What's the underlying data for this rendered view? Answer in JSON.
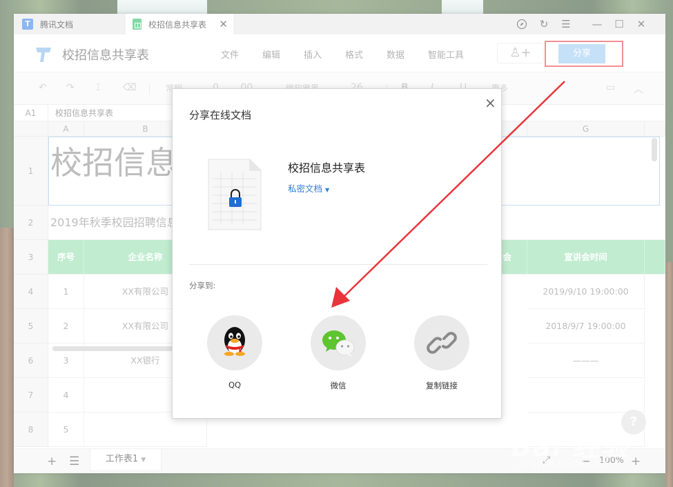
{
  "tabs": [
    {
      "label": "腾讯文档",
      "icon": "tencent-docs-icon"
    },
    {
      "label": "校招信息共享表",
      "icon": "sheet-icon"
    }
  ],
  "window_controls": [
    "compass-icon",
    "refresh-icon",
    "menu-icon",
    "minimize-icon",
    "maximize-icon",
    "close-icon"
  ],
  "header": {
    "doc_title": "校招信息共享表",
    "menu": [
      "文件",
      "编辑",
      "插入",
      "格式",
      "数据",
      "智能工具"
    ],
    "share_button": "分享"
  },
  "toolbar": {
    "format_select": "常规",
    "decimal1": "0",
    "decimal2": ".00",
    "font": "微软雅黑",
    "font_size": "26",
    "bold": "B",
    "italic": "I",
    "underline": "U",
    "more": "更多"
  },
  "formula_bar": {
    "cell_ref": "A1",
    "content": "校招信息共享表"
  },
  "grid": {
    "columns": [
      "A",
      "B",
      "G"
    ],
    "rows": [
      "1",
      "2",
      "3",
      "4",
      "5",
      "6",
      "7",
      "8"
    ],
    "big_title": "校招信息",
    "subtitle": "2019年秋季校园招聘信息",
    "headers": {
      "seq": "序号",
      "company": "企业名称",
      "partial": "会",
      "time": "宣讲会时间"
    },
    "data": [
      {
        "seq": "1",
        "company": "XX有限公司",
        "time": "2019/9/10 19:00:00"
      },
      {
        "seq": "2",
        "company": "XX有限公司",
        "time": "2018/9/7 19:00:00"
      },
      {
        "seq": "3",
        "company": "XX银行",
        "time": "———"
      },
      {
        "seq": "4",
        "company": "",
        "time": ""
      },
      {
        "seq": "5",
        "company": "",
        "time": ""
      }
    ]
  },
  "bottom": {
    "sheet_tab": "工作表1",
    "zoom": "100%",
    "help": "?"
  },
  "dialog": {
    "title": "分享在线文档",
    "doc_name": "校招信息共享表",
    "privacy": "私密文档",
    "share_to": "分享到:",
    "options": [
      {
        "label": "QQ",
        "icon": "qq-penguin-icon"
      },
      {
        "label": "微信",
        "icon": "wechat-icon"
      },
      {
        "label": "复制链接",
        "icon": "link-icon"
      }
    ]
  },
  "watermark": {
    "main": "Bai 经验",
    "sub": "jingyan.baidu.com"
  },
  "colors": {
    "accent_blue": "#96c8f3",
    "header_green": "#8fddaa",
    "annotation_red": "#e8343a",
    "link_blue": "#2f80d8"
  }
}
